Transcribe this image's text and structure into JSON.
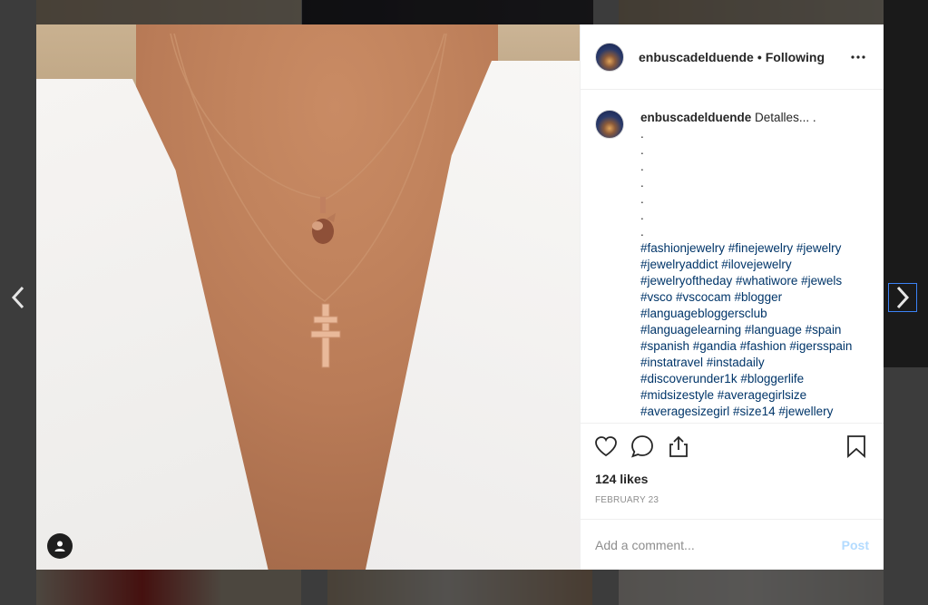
{
  "post": {
    "username": "enbuscadelduende",
    "separator": "•",
    "follow_status": "Following",
    "caption_text": "Detalles... .",
    "caption_dots": [
      ".",
      ".",
      ".",
      ".",
      ".",
      ".",
      "."
    ],
    "hashtags": "#fashionjewelry #finejewelry #jewelry #jewelryaddict #ilovejewelry #jewelryoftheday #whatiwore #jewels #vsco #vscocam #blogger #languagebloggersclub #languagelearning #language #spain #spanish #gandia #fashion #igersspain #instatravel #instadaily #discoverunder1k #bloggerlife #midsizestyle #averagegirlsize #averagesizegirl #size14 #jewellery #necklace #pandora via @preview.app",
    "likes": "124 likes",
    "date": "FEBRUARY 23"
  },
  "comment_form": {
    "placeholder": "Add a comment...",
    "post_label": "Post"
  },
  "icons": {
    "more": "more-dots-icon",
    "like": "heart-icon",
    "comment": "comment-bubble-icon",
    "share": "share-icon",
    "save": "bookmark-icon",
    "prev": "chevron-left-icon",
    "next": "chevron-right-icon",
    "user_tag": "user-tag-icon"
  },
  "colors": {
    "hashtag": "#003569",
    "post_button": "#b3dbff",
    "muted": "#8e8e8e"
  }
}
